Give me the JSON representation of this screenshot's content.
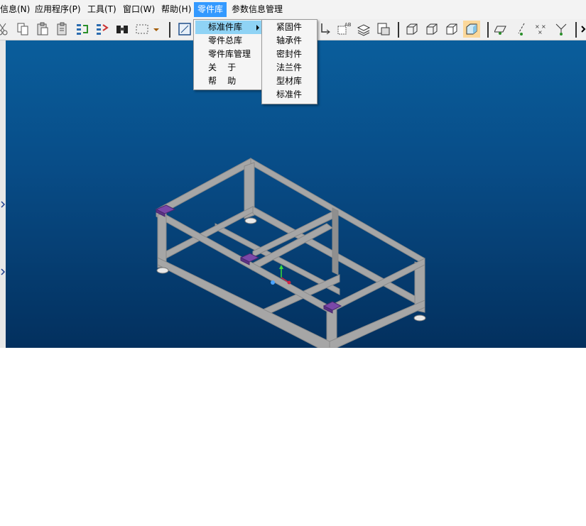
{
  "menubar": {
    "items": [
      {
        "label": "信息(N)"
      },
      {
        "label": "应用程序(P)"
      },
      {
        "label": "工具(T)"
      },
      {
        "label": "窗口(W)"
      },
      {
        "label": "帮助(H)"
      },
      {
        "label": "零件库"
      },
      {
        "label": "参数信息管理"
      }
    ]
  },
  "parts_menu": {
    "items": [
      {
        "label": "标准件库"
      },
      {
        "label": "零件总库"
      },
      {
        "label": "零件库管理"
      },
      {
        "label": "关    于"
      },
      {
        "label": "帮    助"
      }
    ]
  },
  "standard_submenu": {
    "items": [
      {
        "label": "紧固件"
      },
      {
        "label": "轴承件"
      },
      {
        "label": "密封件"
      },
      {
        "label": "法兰件"
      },
      {
        "label": "型材库"
      },
      {
        "label": "标准件"
      }
    ]
  },
  "toolbar": {
    "icons": [
      "cut-icon",
      "copy-icon",
      "paste-icon",
      "paste-special-icon",
      "regen-icon",
      "regen-all-icon",
      "find-icon",
      "select-box-icon",
      "dropdown-icon",
      "sketch-view-icon",
      "datum-icon",
      "annotation-icon",
      "layers-icon",
      "saved-views-icon",
      "wireframe-icon",
      "hidden-line-icon",
      "no-hidden-icon",
      "shading-icon",
      "plane-display-icon",
      "axis-display-icon",
      "point-display-icon",
      "csys-display-icon",
      "more-icon"
    ]
  },
  "colors": {
    "menu_active": "#3399ff",
    "submenu_highlight": "#8fd3f5",
    "viewport_top": "#0a5e9c",
    "viewport_bottom": "#03305e",
    "frame_beam": "#a6a6a6",
    "foot_pad": "#7a48a8"
  }
}
